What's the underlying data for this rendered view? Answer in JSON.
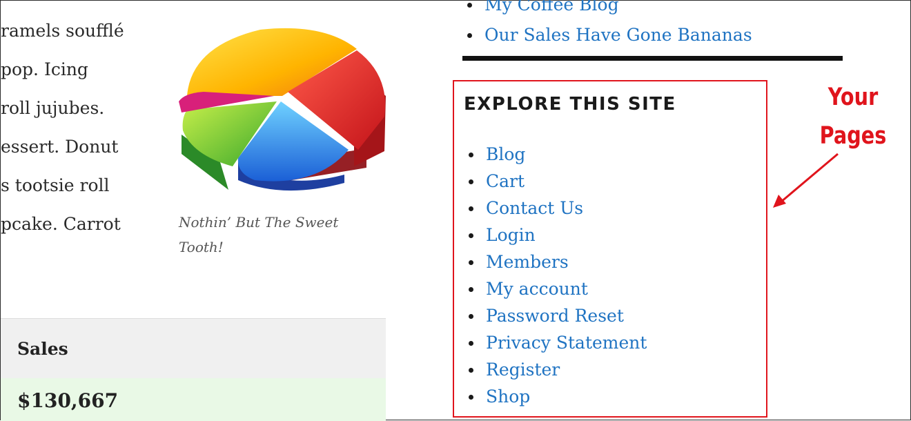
{
  "article": {
    "body_lines": [
      "ramels soufflé",
      "pop. Icing",
      "roll jujubes.",
      "essert. Donut",
      "s tootsie roll",
      "pcake. Carrot"
    ],
    "figure_caption": "Nothin’ But The Sweet Tooth!"
  },
  "sales_table": {
    "header": "Sales",
    "value": "$130,667",
    "header_bg": "#f0f0f0",
    "row_bg": "#e9f9e6"
  },
  "top_list": {
    "items": [
      {
        "label": "My Coffee Blog"
      },
      {
        "label": "Our Sales Have Gone Bananas"
      }
    ]
  },
  "widget": {
    "title": "EXPLORE THIS SITE",
    "pages": [
      {
        "label": "Blog"
      },
      {
        "label": "Cart"
      },
      {
        "label": "Contact Us"
      },
      {
        "label": "Login"
      },
      {
        "label": "Members"
      },
      {
        "label": "My account"
      },
      {
        "label": "Password Reset"
      },
      {
        "label": "Privacy Statement"
      },
      {
        "label": "Register"
      },
      {
        "label": "Shop"
      }
    ],
    "highlight_color": "#e0141c"
  },
  "annotation": {
    "line1": "Your",
    "line2": "Pages",
    "color": "#e0141c"
  },
  "colors": {
    "link": "#1f73c2",
    "text": "#2a2a2a",
    "divider": "#111111"
  },
  "icons": {
    "figure_image": "pie-chart-illustration",
    "annotation_arrow": "arrow-icon"
  }
}
